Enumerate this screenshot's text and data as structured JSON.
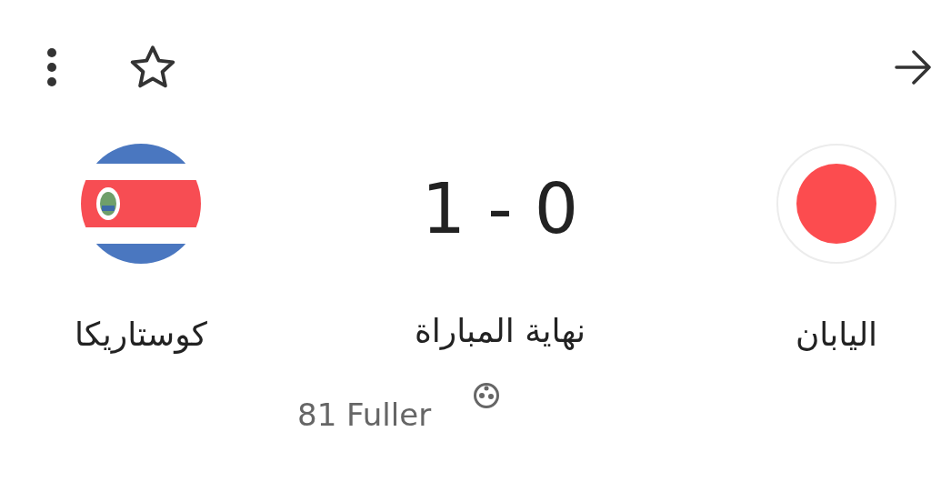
{
  "toolbar": {
    "starred": false
  },
  "teams": [
    {
      "name": "اليابان",
      "kind": "japan"
    },
    {
      "name": "كوستاريكا",
      "kind": "costa_rica"
    }
  ],
  "score": "1 - 0",
  "status": "نهاية المباراة",
  "scorers": [
    "81 Fuller"
  ]
}
